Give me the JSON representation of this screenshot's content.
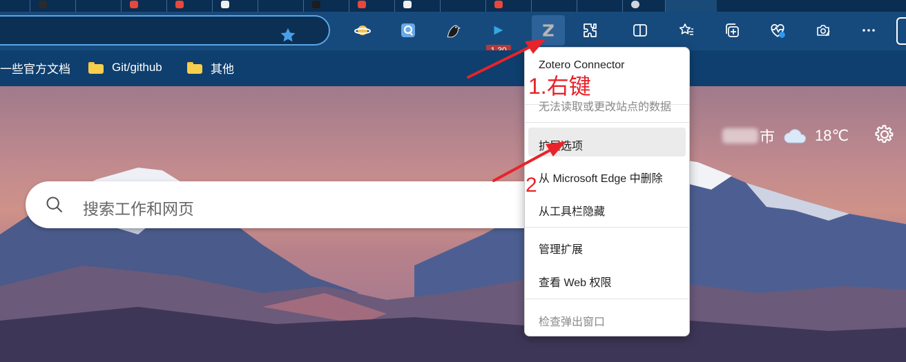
{
  "toolbar": {
    "extension_badge": "1.30"
  },
  "bookmarks": {
    "items": [
      {
        "label": "一些官方文档",
        "icon": "none"
      },
      {
        "label": "Git/github",
        "icon": "folder-icon"
      },
      {
        "label": "其他",
        "icon": "folder-icon"
      }
    ]
  },
  "search": {
    "placeholder": "搜索工作和网页"
  },
  "weather": {
    "city_suffix": "市",
    "temperature": "18℃",
    "condition_icon": "cloud-icon"
  },
  "context_menu": {
    "title": "Zotero Connector",
    "permission_note": "无法读取或更改站点的数据",
    "items": [
      {
        "label": "扩展选项",
        "enabled": true
      },
      {
        "label": "从 Microsoft Edge 中删除",
        "enabled": true
      },
      {
        "label": "从工具栏隐藏",
        "enabled": true
      },
      {
        "label": "管理扩展",
        "enabled": true
      },
      {
        "label": "查看 Web 权限",
        "enabled": true
      },
      {
        "label": "检查弹出窗口",
        "enabled": false
      }
    ]
  },
  "annotations": {
    "step1": "1.右键",
    "step2": "2"
  },
  "colors": {
    "annotation_red": "#e8232a",
    "toolbar_bg": "#174a7c",
    "address_border": "#5aa7e6"
  }
}
